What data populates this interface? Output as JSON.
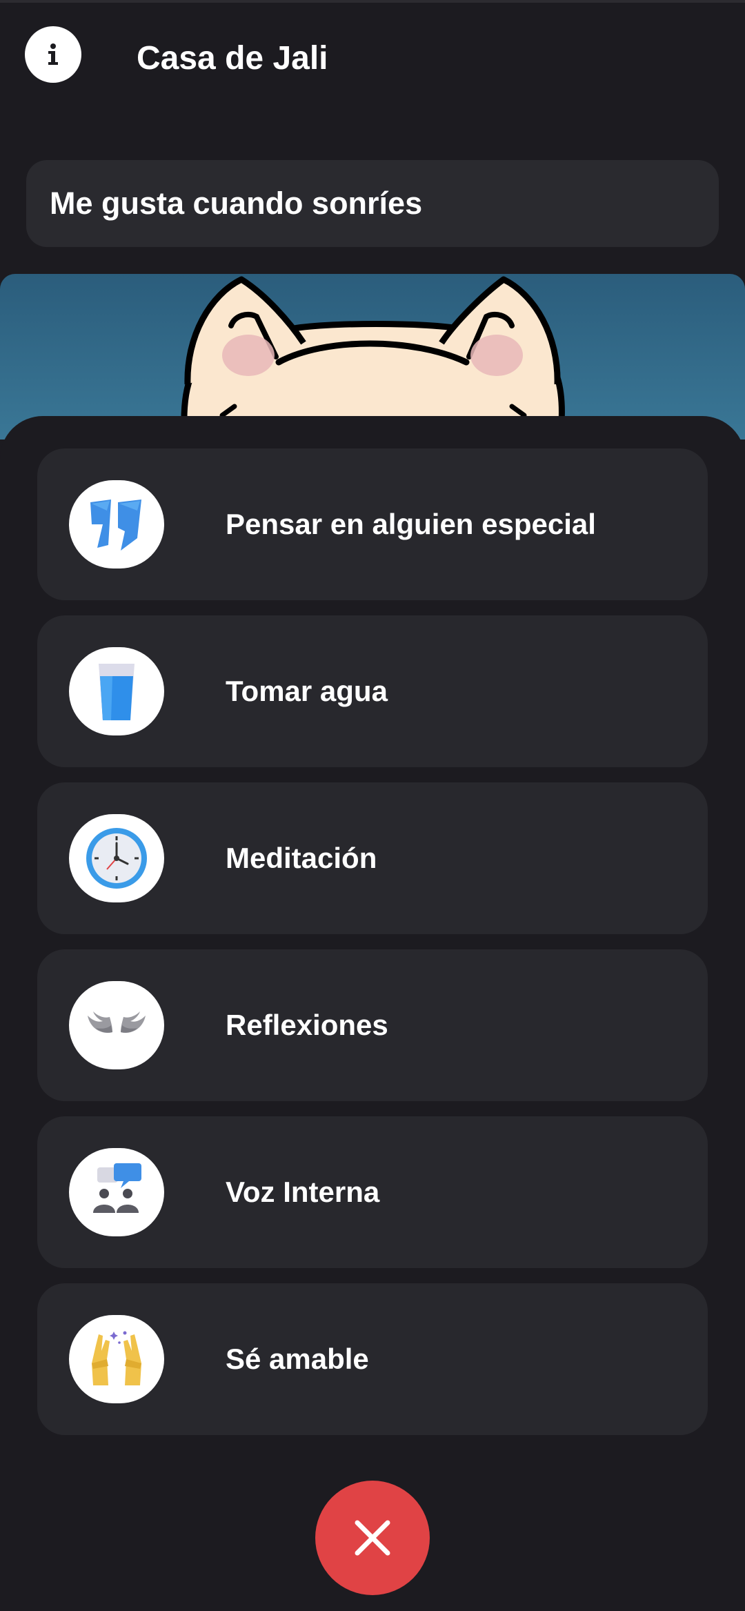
{
  "header": {
    "title": "Casa de Jali",
    "info_icon": "info-icon"
  },
  "message": {
    "text": "Me gusta cuando sonríes"
  },
  "colors": {
    "background": "#1c1b20",
    "card": "#28282d",
    "sky_top": "#2b5d7c",
    "sky_bottom": "#3a7796",
    "close_button": "#e04345"
  },
  "options": [
    {
      "label": "Pensar en alguien especial",
      "icon": "quote-icon"
    },
    {
      "label": "Tomar agua",
      "icon": "water-glass-icon"
    },
    {
      "label": "Meditación",
      "icon": "clock-icon"
    },
    {
      "label": "Reflexiones",
      "icon": "wings-icon"
    },
    {
      "label": "Voz Interna",
      "icon": "speech-bubble-icon"
    },
    {
      "label": "Sé amable",
      "icon": "hands-icon"
    }
  ],
  "close_icon": "close-icon"
}
